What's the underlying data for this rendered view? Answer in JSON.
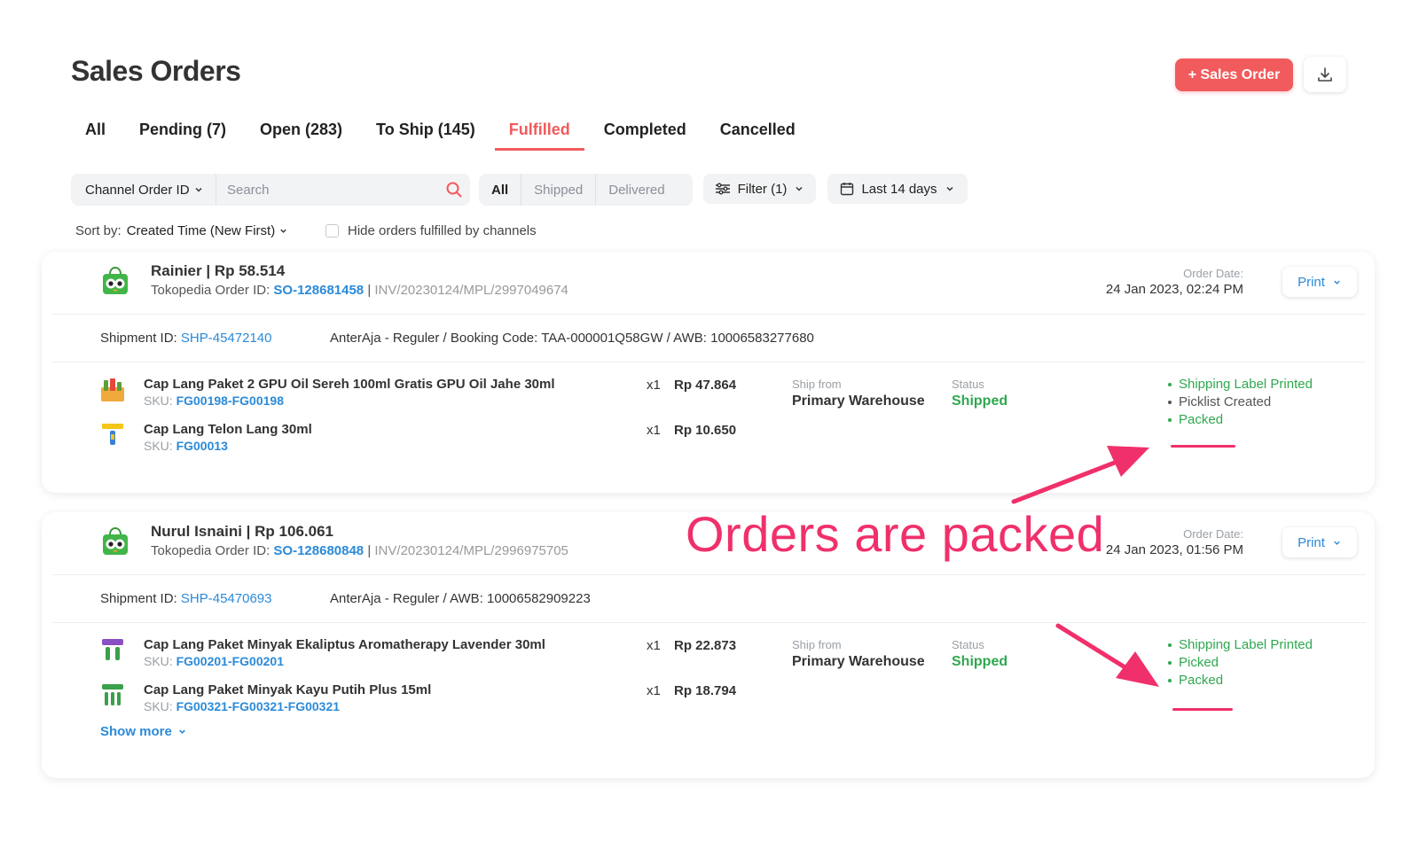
{
  "page": {
    "title": "Sales Orders"
  },
  "header": {
    "add_button_label": "+ Sales Order",
    "download_icon": "download-icon"
  },
  "tabs": [
    {
      "label": "All",
      "active": false
    },
    {
      "label": "Pending (7)",
      "active": false
    },
    {
      "label": "Open (283)",
      "active": false
    },
    {
      "label": "To Ship (145)",
      "active": false
    },
    {
      "label": "Fulfilled",
      "active": true
    },
    {
      "label": "Completed",
      "active": false
    },
    {
      "label": "Cancelled",
      "active": false
    }
  ],
  "search": {
    "field_select": "Channel Order ID",
    "placeholder": "Search"
  },
  "segment": {
    "items": [
      "All",
      "Shipped",
      "Delivered"
    ],
    "selected": "All"
  },
  "filter": {
    "label": "Filter (1)"
  },
  "date_range": {
    "label": "Last 14 days"
  },
  "sort": {
    "label": "Sort by:",
    "value": "Created Time (New First)"
  },
  "hide_option": {
    "label": "Hide orders fulfilled by channels",
    "checked": false
  },
  "orders": [
    {
      "customer": "Rainier | Rp 58.514",
      "order_id_label": "Tokopedia Order ID:",
      "order_id": "SO-128681458",
      "separator": " | ",
      "invoice": "INV/20230124/MPL/2997049674",
      "order_date_label": "Order Date:",
      "order_date": "24 Jan 2023, 02:24 PM",
      "print_label": "Print",
      "shipment_label": "Shipment ID:",
      "shipment_id": "SHP-45472140",
      "courier": "AnterAja - Reguler / Booking Code: TAA-000001Q58GW / AWB: 10006583277680",
      "ship_from_label": "Ship from",
      "ship_from": "Primary Warehouse",
      "status_label": "Status",
      "status": "Shipped",
      "items": [
        {
          "name": "Cap Lang Paket 2 GPU Oil Sereh 100ml Gratis GPU Oil Jahe 30ml",
          "sku_label": "SKU:",
          "sku": "FG00198-FG00198",
          "qty": "x1",
          "price": "Rp 47.864"
        },
        {
          "name": "Cap Lang Telon Lang 30ml",
          "sku_label": "SKU:",
          "sku": "FG00013",
          "qty": "x1",
          "price": "Rp 10.650"
        }
      ],
      "steps": [
        {
          "label": "Shipping Label Printed",
          "done": true
        },
        {
          "label": "Picklist Created",
          "done": false
        },
        {
          "label": "Packed",
          "done": true
        }
      ]
    },
    {
      "customer": "Nurul Isnaini | Rp 106.061",
      "order_id_label": "Tokopedia Order ID:",
      "order_id": "SO-128680848",
      "separator": " | ",
      "invoice": "INV/20230124/MPL/2996975705",
      "order_date_label": "Order Date:",
      "order_date": "24 Jan 2023, 01:56 PM",
      "print_label": "Print",
      "shipment_label": "Shipment ID:",
      "shipment_id": "SHP-45470693",
      "courier": "AnterAja - Reguler / AWB: 10006582909223",
      "ship_from_label": "Ship from",
      "ship_from": "Primary Warehouse",
      "status_label": "Status",
      "status": "Shipped",
      "items": [
        {
          "name": "Cap Lang Paket Minyak Ekaliptus Aromatherapy Lavender 30ml",
          "sku_label": "SKU:",
          "sku": "FG00201-FG00201",
          "qty": "x1",
          "price": "Rp 22.873"
        },
        {
          "name": "Cap Lang Paket Minyak Kayu Putih Plus 15ml",
          "sku_label": "SKU:",
          "sku": "FG00321-FG00321-FG00321",
          "qty": "x1",
          "price": "Rp 18.794"
        }
      ],
      "show_more": "Show more",
      "steps": [
        {
          "label": "Shipping Label Printed",
          "done": true
        },
        {
          "label": "Picked",
          "done": true
        },
        {
          "label": "Packed",
          "done": true
        }
      ]
    }
  ],
  "annotation": {
    "text": "Orders are packed",
    "color": "#f0306a"
  },
  "colors": {
    "accent": "#f15b5d",
    "link": "#2b8ad8",
    "success": "#2fa84f",
    "annotation": "#f0306a"
  }
}
